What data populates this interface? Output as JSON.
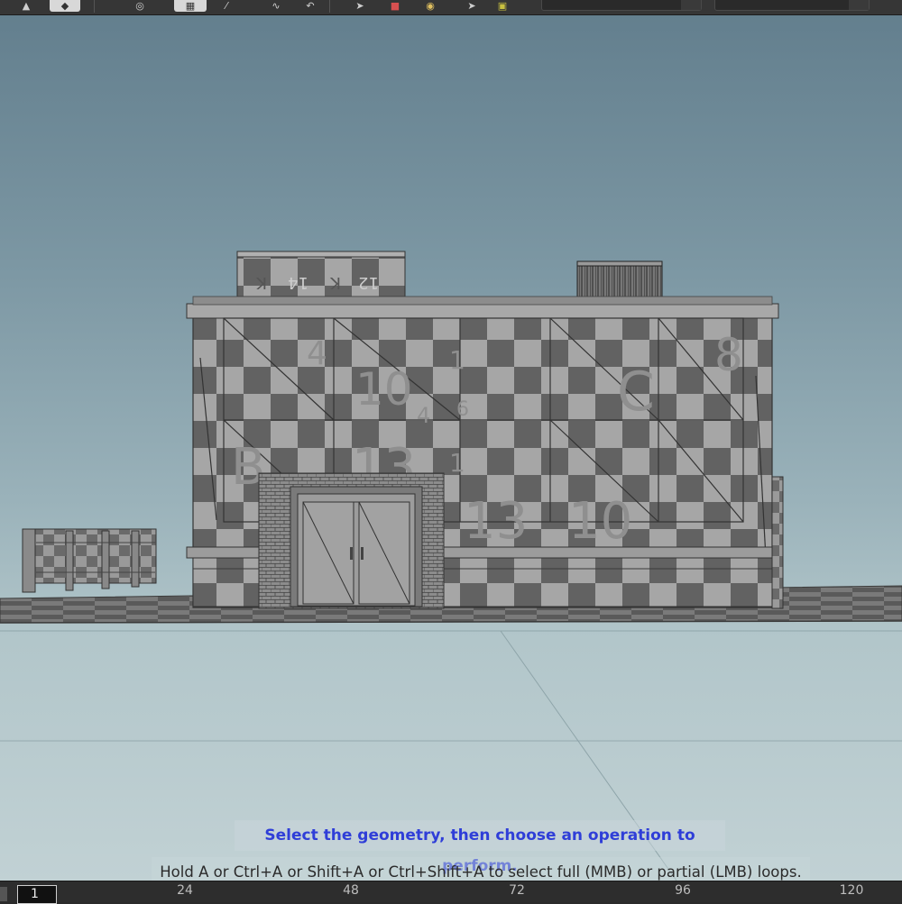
{
  "toolbar": {
    "tools": [
      {
        "name": "handle-tool",
        "icon": "arrow-flag-icon"
      },
      {
        "name": "pose-tool",
        "icon": "diamond-icon"
      },
      {
        "name": "snap-to-point",
        "icon": "target-icon"
      },
      {
        "name": "viewport-layout",
        "icon": "layout-grid-icon"
      },
      {
        "name": "brush-tool",
        "icon": "brush-icon"
      },
      {
        "name": "bend-tool",
        "icon": "curve-icon"
      },
      {
        "name": "loop-select",
        "icon": "loop-icon"
      },
      {
        "name": "select-tool",
        "icon": "cursor-icon"
      },
      {
        "name": "render-region",
        "icon": "render-icon"
      },
      {
        "name": "camera-tool",
        "icon": "aperture-icon"
      },
      {
        "name": "pick-tool",
        "icon": "pick-cursor-icon"
      },
      {
        "name": "display-options",
        "icon": "display-icon"
      }
    ]
  },
  "viewport": {
    "hint_primary": "Select the geometry, then choose an operation to perform.",
    "hint_secondary": "Hold A or Ctrl+A or Shift+A or Ctrl+Shift+A to select full (MMB) or partial (LMB) loops.",
    "facade_labels": [
      "4",
      "10",
      "1",
      "C",
      "8",
      "B",
      "13",
      "1",
      "13",
      "10",
      "4",
      "6"
    ],
    "roof_labels": [
      "K",
      "14",
      "K",
      "12"
    ]
  },
  "timeline": {
    "current_frame": "1",
    "ticks": [
      "24",
      "48",
      "72",
      "96",
      "120"
    ]
  },
  "colors": {
    "hint_primary": "#2f3ed8",
    "checker_dark": "#5c5c5c",
    "checker_light": "#a6a6a6",
    "sky_top": "#637f8e",
    "sky_bottom": "#c1d1d4"
  }
}
